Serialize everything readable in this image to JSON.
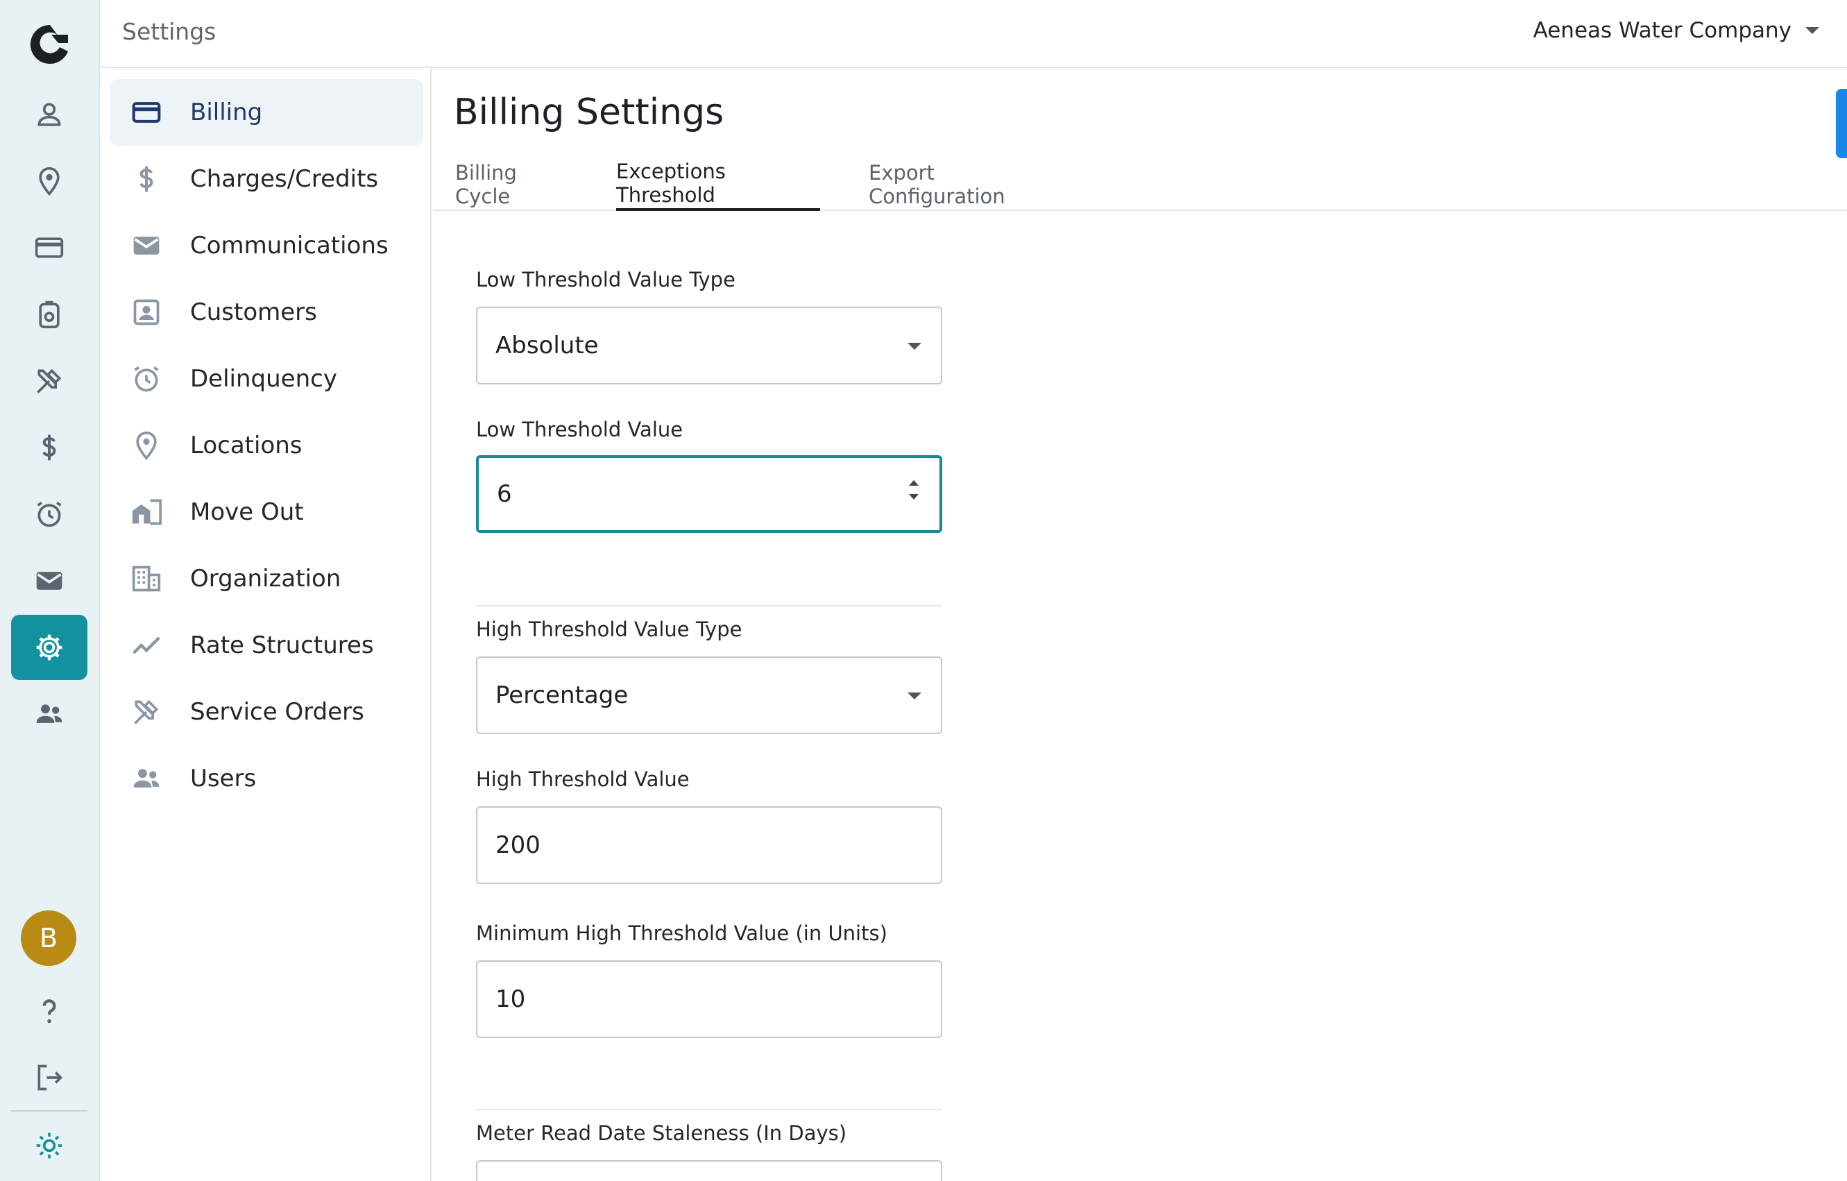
{
  "header": {
    "breadcrumb": "Settings",
    "organization": "Aeneas Water Company"
  },
  "rail": {
    "items": [
      "user-icon",
      "location-pin-icon",
      "credit-card-icon",
      "meter-icon",
      "tools-icon",
      "dollar-icon",
      "alarm-clock-icon",
      "mail-icon",
      "gear-icon",
      "users-icon"
    ],
    "active": "gear-icon",
    "avatar_initial": "B",
    "accent_color": "#13919f"
  },
  "sidebar": {
    "items": [
      {
        "label": "Billing",
        "icon": "credit-card-icon"
      },
      {
        "label": "Charges/Credits",
        "icon": "dollar-icon"
      },
      {
        "label": "Communications",
        "icon": "mail-icon"
      },
      {
        "label": "Customers",
        "icon": "contact-card-icon"
      },
      {
        "label": "Delinquency",
        "icon": "alarm-clock-icon"
      },
      {
        "label": "Locations",
        "icon": "location-pin-icon"
      },
      {
        "label": "Move Out",
        "icon": "houses-icon"
      },
      {
        "label": "Organization",
        "icon": "building-icon"
      },
      {
        "label": "Rate Structures",
        "icon": "trend-line-icon"
      },
      {
        "label": "Service Orders",
        "icon": "tools-icon"
      },
      {
        "label": "Users",
        "icon": "users-icon"
      }
    ],
    "active": "Billing"
  },
  "main": {
    "title": "Billing Settings",
    "tabs": [
      {
        "label": "Billing Cycle"
      },
      {
        "label": "Exceptions Threshold"
      },
      {
        "label": "Export Configuration"
      }
    ],
    "active_tab": "Exceptions Threshold",
    "form": {
      "low_type_label": "Low Threshold Value Type",
      "low_type_value": "Absolute",
      "low_value_label": "Low Threshold Value",
      "low_value": "6",
      "high_type_label": "High Threshold Value Type",
      "high_type_value": "Percentage",
      "high_value_label": "High Threshold Value",
      "high_value": "200",
      "min_high_label": "Minimum High Threshold Value (in Units)",
      "min_high_value": "10",
      "staleness_label": "Meter Read Date Staleness (In Days)"
    }
  }
}
